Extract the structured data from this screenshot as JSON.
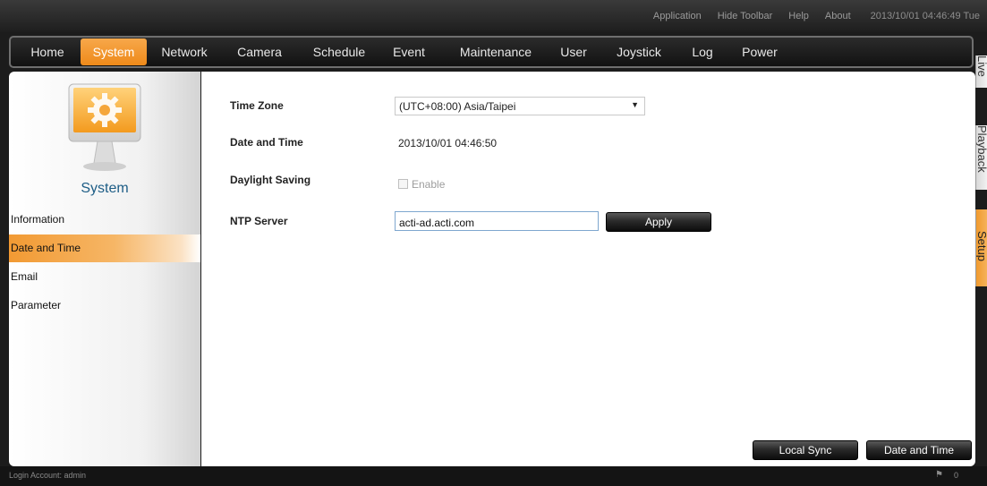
{
  "toplinks": {
    "application": "Application",
    "hide_toolbar": "Hide Toolbar",
    "help": "Help",
    "about": "About",
    "clock": "2013/10/01 04:46:49 Tue"
  },
  "nav": {
    "home": "Home",
    "system": "System",
    "network": "Network",
    "camera": "Camera",
    "schedule": "Schedule",
    "event": "Event",
    "maintenance": "Maintenance",
    "user": "User",
    "joystick": "Joystick",
    "log": "Log",
    "power": "Power",
    "active": "System"
  },
  "side_tabs": {
    "live": "Live",
    "playback": "Playback",
    "setup": "Setup",
    "active": "Setup"
  },
  "sidebar": {
    "title": "System",
    "icon": "monitor-gear-icon",
    "items": [
      {
        "label": "Information"
      },
      {
        "label": "Date and Time"
      },
      {
        "label": "Email"
      },
      {
        "label": "Parameter"
      }
    ],
    "active": "Date and Time"
  },
  "form": {
    "time_zone_label": "Time Zone",
    "time_zone_value": "(UTC+08:00) Asia/Taipei",
    "date_time_label": "Date and Time",
    "date_time_value": "2013/10/01 04:46:50",
    "daylight_label": "Daylight Saving",
    "daylight_option": "Enable",
    "daylight_checked": false,
    "ntp_label": "NTP Server",
    "ntp_value": "acti-ad.acti.com",
    "apply_label": "Apply"
  },
  "footer_buttons": {
    "local_sync": "Local Sync",
    "date_and_time": "Date and Time"
  },
  "status": {
    "login": "Login Account: admin",
    "alert_icon": "alarm-icon",
    "alert_count": "0"
  },
  "colors": {
    "accent": "#f28c1e",
    "title_blue": "#1d5d86"
  }
}
